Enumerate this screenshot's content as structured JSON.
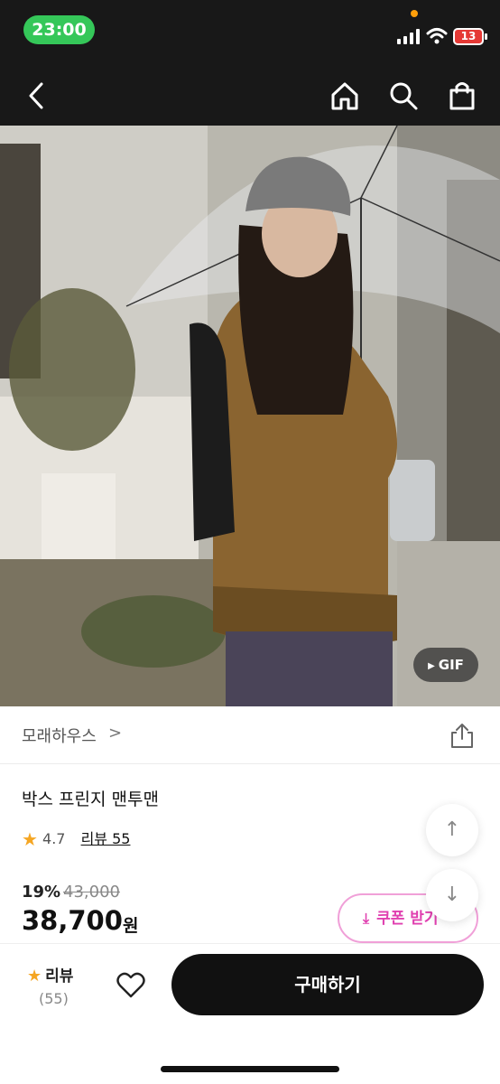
{
  "status_bar": {
    "time": "23:00",
    "battery": "13"
  },
  "nav": {
    "back_icon": "chevron-left-icon",
    "home_icon": "home-icon",
    "search_icon": "search-icon",
    "cart_icon": "shopping-bag-icon"
  },
  "photo": {
    "badge": "GIF"
  },
  "shop": {
    "name": "모래하우스",
    "chevron": ">"
  },
  "product": {
    "title": "박스 프린지 맨투맨",
    "rating": "4.7",
    "review_label": "리뷰 55",
    "discount": "19%",
    "original_price": "43,000",
    "price": "38,700",
    "currency": "원"
  },
  "coupon": {
    "label": "쿠폰 받기"
  },
  "scroll": {
    "up": "↑",
    "down": "↓"
  },
  "bottom_bar": {
    "review_label": "리뷰",
    "review_count": "(55)",
    "buy_label": "구매하기"
  },
  "colors": {
    "status_green": "#35c759",
    "coupon_pink": "#e040b0",
    "star": "#f5a623"
  }
}
